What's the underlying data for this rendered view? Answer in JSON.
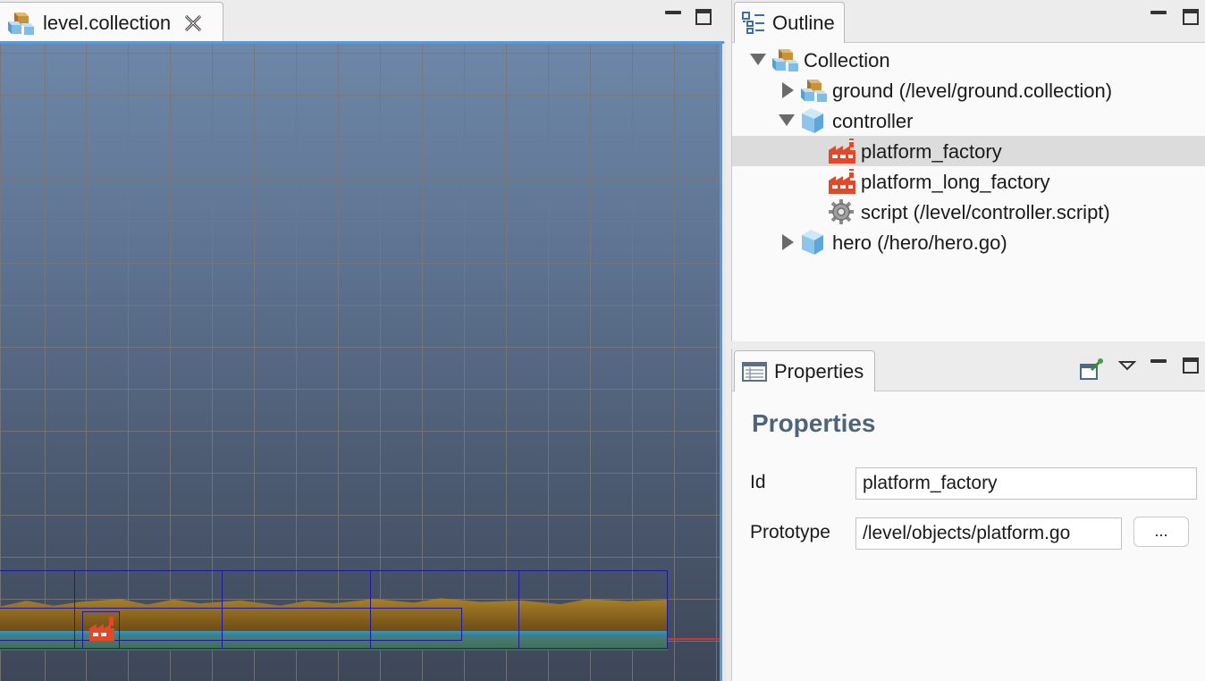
{
  "editor": {
    "tab_label": "level.collection",
    "tab_icon": "collection-icon",
    "close_icon": "close-icon",
    "accent_color": "#5b9bd5"
  },
  "outline": {
    "tab_label": "Outline",
    "tab_icon": "outline-icon",
    "tree": [
      {
        "label": "Collection",
        "icon": "collection-icon",
        "expanded": true
      },
      {
        "label": "ground (/level/ground.collection)",
        "icon": "collection-icon",
        "expanded": false
      },
      {
        "label": "controller",
        "icon": "game-object-icon",
        "expanded": true
      },
      {
        "label": "platform_factory",
        "icon": "factory-icon",
        "selected": true
      },
      {
        "label": "platform_long_factory",
        "icon": "factory-icon"
      },
      {
        "label": "script (/level/controller.script)",
        "icon": "gear-icon"
      },
      {
        "label": "hero (/hero/hero.go)",
        "icon": "game-object-icon",
        "expanded": false
      }
    ]
  },
  "properties": {
    "tab_label": "Properties",
    "tab_icon": "properties-icon",
    "title": "Properties",
    "id_label": "Id",
    "id_value": "platform_factory",
    "prototype_label": "Prototype",
    "prototype_value": "/level/objects/platform.go",
    "browse_label": "..."
  },
  "colors": {
    "selection_row": "#dcdcdc",
    "title_color": "#4e6478"
  }
}
